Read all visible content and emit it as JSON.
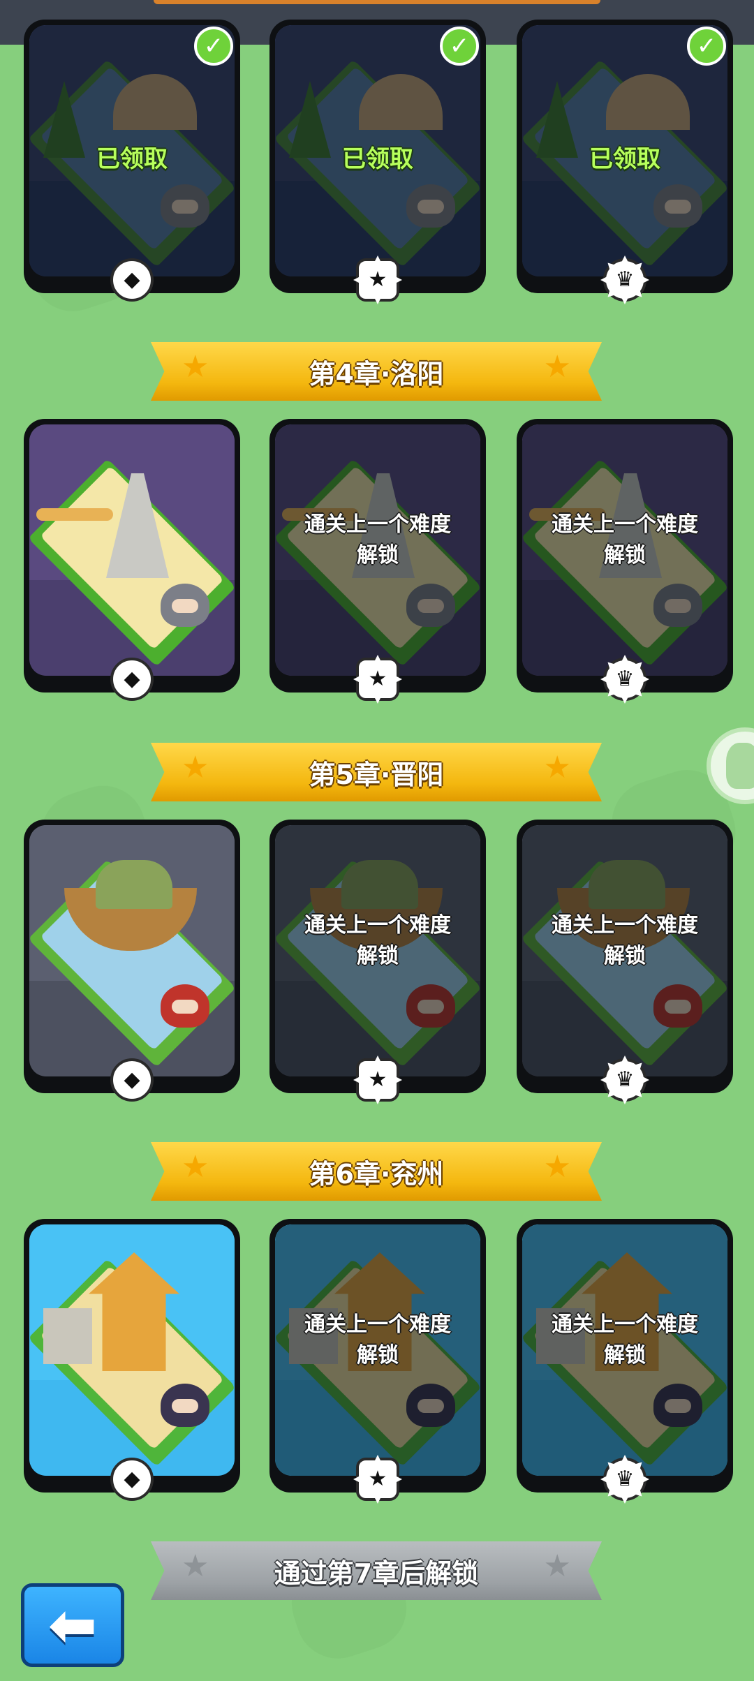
{
  "chapters": [
    {
      "title": "",
      "cards": [
        {
          "state": "claimed",
          "text": "已领取",
          "difficulty": "normal",
          "check": "✓"
        },
        {
          "state": "claimed",
          "text": "已领取",
          "difficulty": "hard",
          "check": "✓"
        },
        {
          "state": "claimed",
          "text": "已领取",
          "difficulty": "hell",
          "check": "✓"
        }
      ]
    },
    {
      "title": "第4章·洛阳",
      "cards": [
        {
          "state": "open",
          "difficulty": "normal"
        },
        {
          "state": "locked",
          "line1": "通关上一个难度",
          "line2": "解锁",
          "difficulty": "hard"
        },
        {
          "state": "locked",
          "line1": "通关上一个难度",
          "line2": "解锁",
          "difficulty": "hell"
        }
      ]
    },
    {
      "title": "第5章·晋阳",
      "cards": [
        {
          "state": "open",
          "difficulty": "normal"
        },
        {
          "state": "locked",
          "line1": "通关上一个难度",
          "line2": "解锁",
          "difficulty": "hard"
        },
        {
          "state": "locked",
          "line1": "通关上一个难度",
          "line2": "解锁",
          "difficulty": "hell"
        }
      ]
    },
    {
      "title": "第6章·兖州",
      "cards": [
        {
          "state": "open",
          "difficulty": "normal"
        },
        {
          "state": "locked",
          "line1": "通关上一个难度",
          "line2": "解锁",
          "difficulty": "hard"
        },
        {
          "state": "locked",
          "line1": "通关上一个难度",
          "line2": "解锁",
          "difficulty": "hell"
        }
      ]
    }
  ],
  "locked_banner": {
    "title": "通过第7章后解锁"
  },
  "icons": {
    "banner_star": "★",
    "badge_normal": "◆",
    "badge_hard": "★",
    "badge_hell": "♛",
    "back_arrow": "⬅"
  },
  "colors": {
    "background": "#86cf7d",
    "banner_gold": "#f4b70f",
    "banner_grey": "#9da2a6",
    "claimed_text": "#b7ff5c"
  }
}
